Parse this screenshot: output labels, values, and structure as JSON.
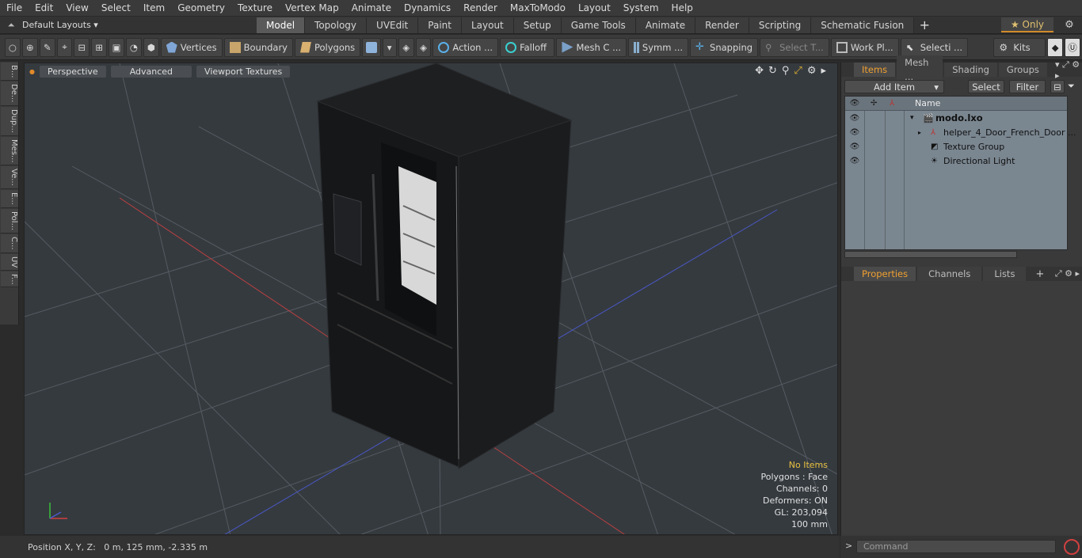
{
  "menu": [
    "File",
    "Edit",
    "View",
    "Select",
    "Item",
    "Geometry",
    "Texture",
    "Vertex Map",
    "Animate",
    "Dynamics",
    "Render",
    "MaxToModo",
    "Layout",
    "System",
    "Help"
  ],
  "layoutbar": {
    "layouts_label": "Default Layouts ▾",
    "tabs": [
      "Model",
      "Topology",
      "UVEdit",
      "Paint",
      "Layout",
      "Setup",
      "Game Tools",
      "Animate",
      "Render",
      "Scripting",
      "Schematic Fusion"
    ],
    "active_tab": "Model",
    "only_label": "★ Only"
  },
  "toolbar": {
    "vertices": "Vertices",
    "boundary": "Boundary",
    "polygons": "Polygons",
    "action": "Action ...",
    "falloff": "Falloff",
    "mesh": "Mesh C ...",
    "symm": "Symm ...",
    "snapping": "Snapping",
    "select_t": "Select T...",
    "work_pl": "Work Pl...",
    "selecti": "Selecti ...",
    "kits": "Kits"
  },
  "left_strip": [
    "B...",
    "De...",
    "Dup...",
    "Mes...",
    "Ve...",
    "E...",
    "Pol...",
    "C...",
    "UV",
    "F..."
  ],
  "viewport": {
    "perspective": "Perspective",
    "advanced": "Advanced",
    "textures": "Viewport Textures",
    "info": {
      "items": "No Items",
      "polygons": "Polygons : Face",
      "channels": "Channels: 0",
      "deformers": "Deformers: ON",
      "gl": "GL: 203,094",
      "scale": "100 mm"
    }
  },
  "status": "Position X, Y, Z:   0 m, 125 mm, -2.335 m",
  "items_panel": {
    "tabs": [
      "Items",
      "Mesh ...",
      "Shading",
      "Groups"
    ],
    "add_item": "Add Item",
    "select": "Select",
    "filter": "Filter",
    "name_col": "Name",
    "rows": [
      "modo.lxo",
      "helper_4_Door_French_Door ...",
      "Texture Group",
      "Directional Light"
    ]
  },
  "props_panel": {
    "tabs": [
      "Properties",
      "Channels",
      "Lists"
    ]
  },
  "command": {
    "placeholder": "Command"
  },
  "colors": {
    "accent": "#f0a030",
    "viewport_bg": "#353a3f"
  }
}
